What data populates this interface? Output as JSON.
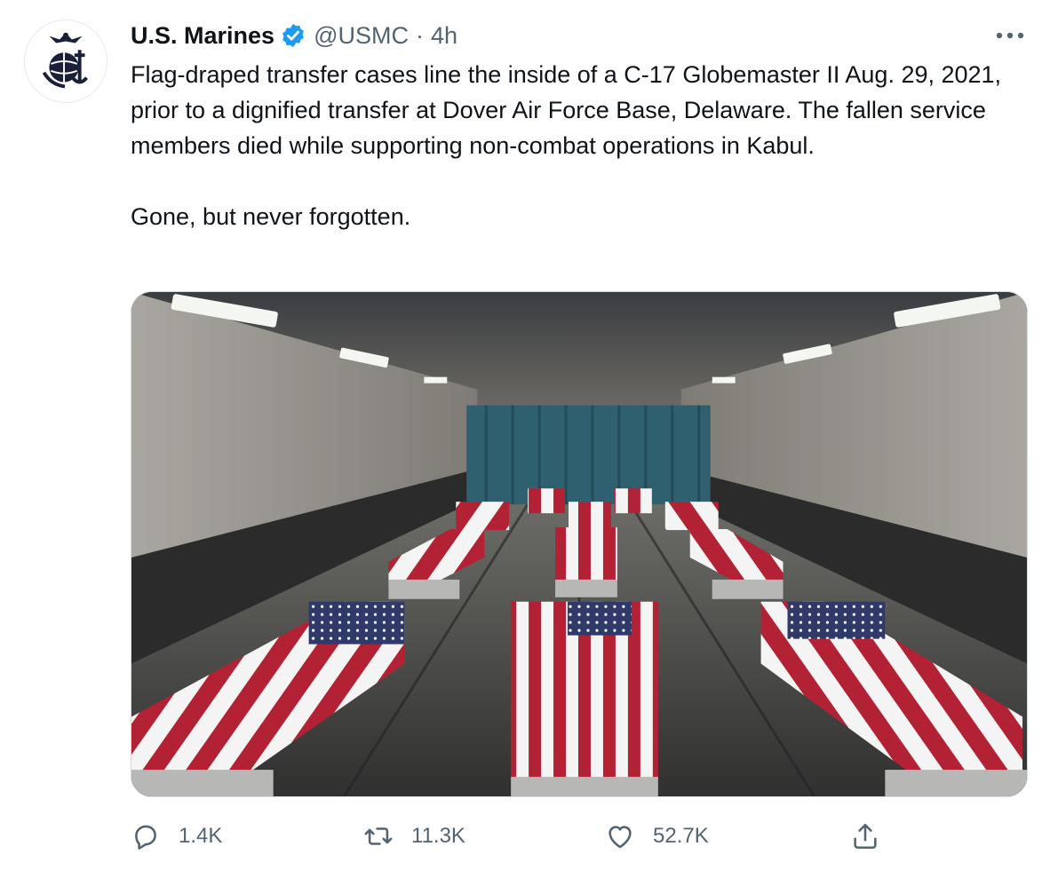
{
  "tweet": {
    "author_name": "U.S. Marines",
    "handle": "@USMC",
    "separator": "·",
    "time": "4h",
    "text": "Flag-draped transfer cases line the inside of a C-17 Globemaster II Aug. 29, 2021, prior to a dignified transfer at Dover Air Force Base, Delaware. The fallen service members died while supporting non-combat operations in Kabul.\n\nGone, but never forgotten.",
    "media_description": "photo-flag-draped-cases-in-aircraft-cargo-hold"
  },
  "icons": {
    "avatar": "marine-corps-emblem-icon",
    "verified": "verified-badge-icon",
    "more": "more-options-icon",
    "reply": "reply-icon",
    "retweet": "retweet-icon",
    "like": "heart-icon",
    "share": "share-icon"
  },
  "actions": {
    "replies": "1.4K",
    "retweets": "11.3K",
    "likes": "52.7K"
  },
  "colors": {
    "text": "#0f1419",
    "secondary": "#536471",
    "verified": "#1d9bf0",
    "flag_red": "#b22234",
    "flag_blue": "#3c3b6e"
  }
}
